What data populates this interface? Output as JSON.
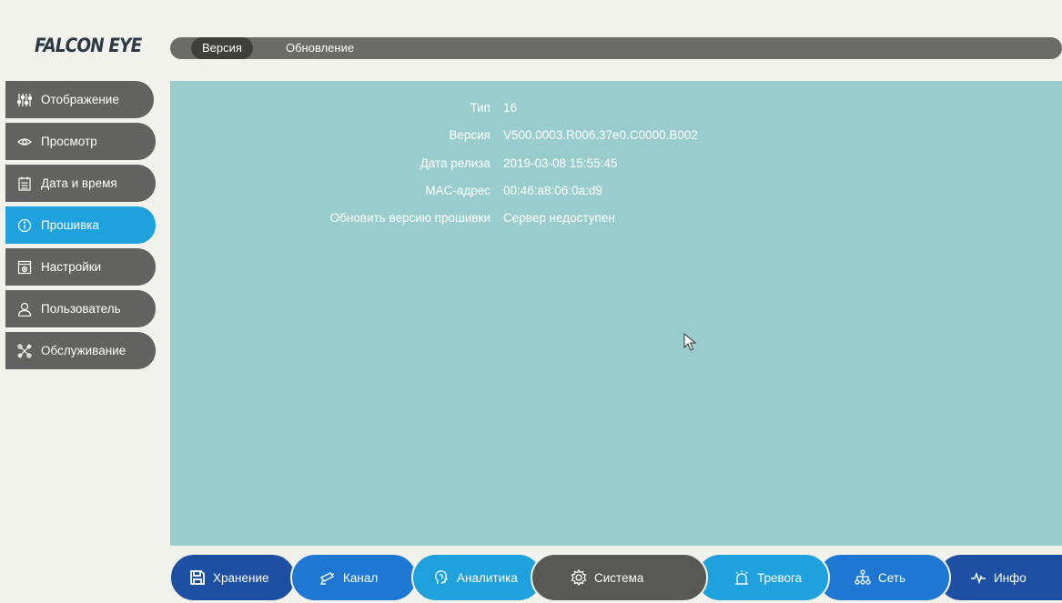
{
  "brand": {
    "logo_text": "FALCON EYE"
  },
  "tabs": [
    {
      "label": "Версия",
      "active": true
    },
    {
      "label": "Обновление",
      "active": false
    }
  ],
  "sidebar": {
    "items": [
      {
        "label": "Отображение",
        "icon": "sliders-icon",
        "active": false
      },
      {
        "label": "Просмотр",
        "icon": "eye-icon",
        "active": false
      },
      {
        "label": "Дата и время",
        "icon": "calendar-icon",
        "active": false
      },
      {
        "label": "Прошивка",
        "icon": "info-icon",
        "active": true
      },
      {
        "label": "Настройки",
        "icon": "settings-window-icon",
        "active": false
      },
      {
        "label": "Пользователь",
        "icon": "user-icon",
        "active": false
      },
      {
        "label": "Обслуживание",
        "icon": "tools-icon",
        "active": false
      }
    ]
  },
  "info": {
    "rows": [
      {
        "label": "Тип",
        "value": "16"
      },
      {
        "label": "Версия",
        "value": "V500.0003.R006.37e0.C0000.B002"
      },
      {
        "label": "Дата релиза",
        "value": "2019-03-08 15:55:45"
      },
      {
        "label": "MAC-адрес",
        "value": "00:46:a8:06:0a:d9"
      },
      {
        "label": "Обновить версию прошивки",
        "value": "Сервер недоступен"
      }
    ]
  },
  "bottom_nav": {
    "items": [
      {
        "label": "Хранение",
        "icon": "save-icon",
        "color": "#1d4fa3"
      },
      {
        "label": "Канал",
        "icon": "camera-icon",
        "color": "#1e78d3"
      },
      {
        "label": "Аналитика",
        "icon": "brain-icon",
        "color": "#1ea1dc"
      },
      {
        "label": "Система",
        "icon": "gear-icon",
        "color": "#585855"
      },
      {
        "label": "Тревога",
        "icon": "alarm-icon",
        "color": "#1ea1dc"
      },
      {
        "label": "Сеть",
        "icon": "network-icon",
        "color": "#1e78d3"
      },
      {
        "label": "Инфо",
        "icon": "pulse-icon",
        "color": "#1d4fa3"
      }
    ]
  },
  "colors": {
    "accent": "#1ea1dc",
    "panel": "#99cccc",
    "sidebar_item": "#626260",
    "topbar": "#6b6b67"
  }
}
